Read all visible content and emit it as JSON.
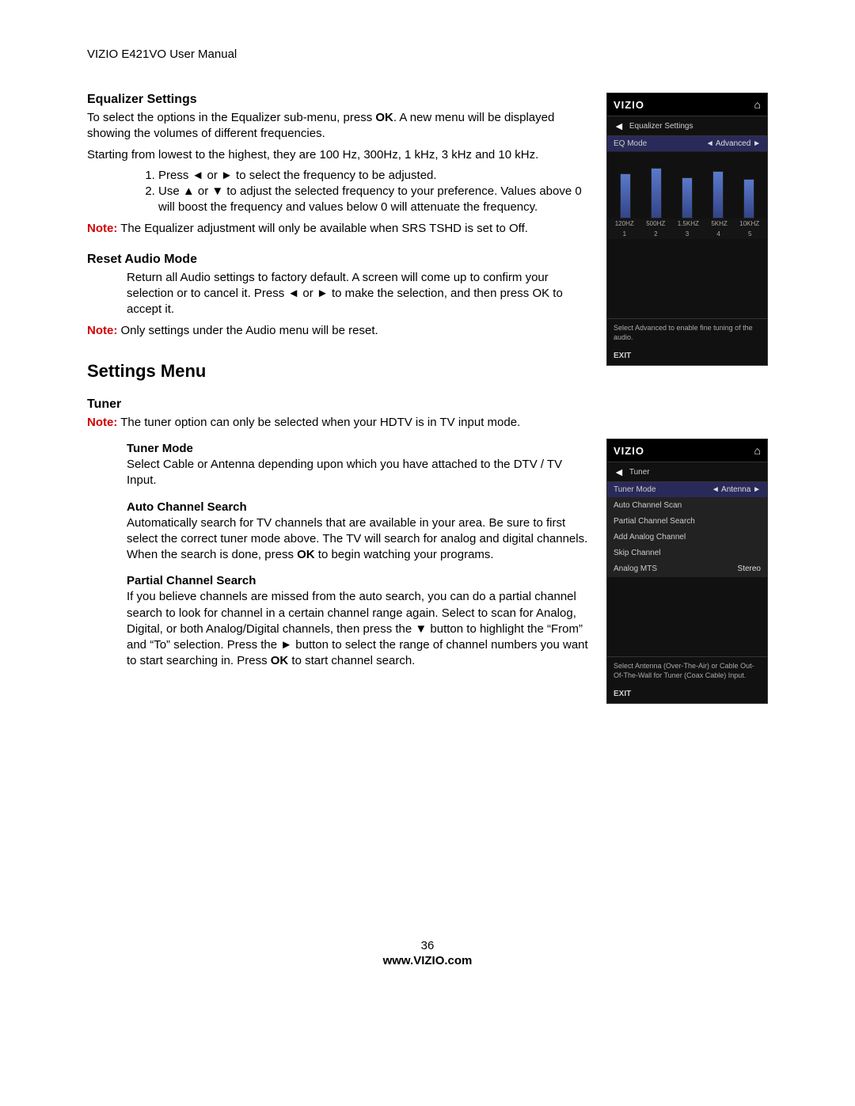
{
  "doc_header": "VIZIO E421VO User Manual",
  "eq": {
    "title": "Equalizer Settings",
    "intro_a": "To select the options in the Equalizer sub-menu, press ",
    "intro_ok": "OK",
    "intro_b": ". A new menu will be displayed showing the volumes of different frequencies.",
    "freq_line": "Starting from lowest to the highest, they are 100 Hz, 300Hz, 1 kHz, 3 kHz and 10 kHz.",
    "step1": "Press ◄ or ► to select the frequency to be adjusted.",
    "step2": "Use ▲ or ▼ to adjust the selected frequency to your preference. Values above 0 will boost the frequency and values below 0 will attenuate the frequency.",
    "note_label": "Note:",
    "note_text": " The Equalizer adjustment will only be available when SRS TSHD is set to Off."
  },
  "reset": {
    "title": "Reset Audio Mode",
    "body": "Return all Audio settings to factory default. A screen will come up to confirm your selection or to cancel it. Press ◄ or ► to make the selection, and then press OK to accept it.",
    "note_label": "Note:",
    "note_text": " Only settings under the Audio menu will be reset."
  },
  "settings_menu": "Settings Menu",
  "tuner": {
    "title": "Tuner",
    "note_label": "Note:",
    "note_text": " The tuner option can only be selected when your HDTV is in TV input mode.",
    "mode_title": "Tuner Mode",
    "mode_body": "Select Cable or Antenna depending upon which you have attached to the DTV / TV Input.",
    "auto_title": "Auto Channel Search",
    "auto_body_a": "Automatically search for TV channels that are available in your area. Be sure to first select the correct tuner mode above. The TV will search for analog and digital channels. When the search is done, press ",
    "auto_ok": "OK",
    "auto_body_b": " to begin watching your programs.",
    "partial_title": "Partial Channel Search",
    "partial_body_a": "If you believe channels are missed from the auto search, you can do a partial channel search to look for channel in a certain channel range again. Select to scan for Analog, Digital, or both Analog/Digital channels, then press the ▼ button to highlight the “From” and “To” selection. Press the ► button to select the range of channel numbers you want to start searching in. Press ",
    "partial_ok": "OK",
    "partial_body_b": " to start channel search."
  },
  "osd1": {
    "logo": "VIZIO",
    "breadcrumb": "Equalizer Settings",
    "eq_mode": "EQ Mode",
    "eq_mode_val": "Advanced",
    "freq_labels": [
      "120HZ",
      "500HZ",
      "1.5KHZ",
      "5KHZ",
      "10KHZ"
    ],
    "freq_nums": [
      "1",
      "2",
      "3",
      "4",
      "5"
    ],
    "help": "Select Advanced to enable fine tuning of the audio.",
    "exit": "EXIT"
  },
  "osd2": {
    "logo": "VIZIO",
    "breadcrumb": "Tuner",
    "tuner_mode": "Tuner Mode",
    "tuner_mode_val": "Antenna",
    "items": [
      "Auto Channel Scan",
      "Partial Channel Search",
      "Add Analog Channel",
      "Skip Channel"
    ],
    "mts": "Analog MTS",
    "mts_val": "Stereo",
    "help": "Select Antenna (Over-The-Air) or Cable Out-Of-The-Wall for Tuner (Coax Cable) Input.",
    "exit": "EXIT"
  },
  "footer": {
    "page": "36",
    "site": "www.VIZIO.com"
  }
}
